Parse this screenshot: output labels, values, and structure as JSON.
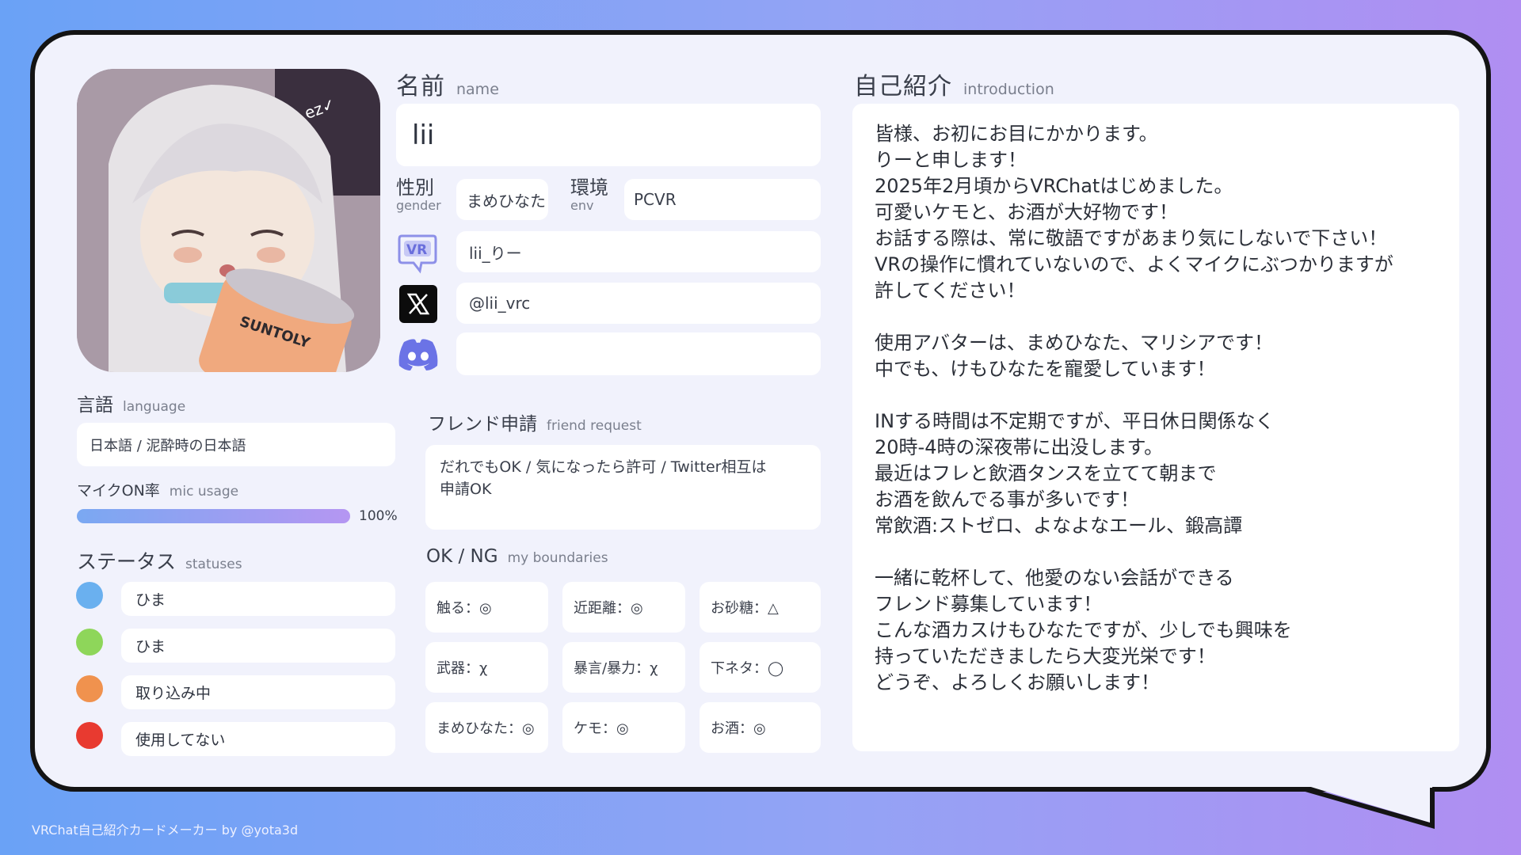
{
  "name_section": {
    "label_jp": "名前",
    "label_en": "name",
    "value": "lii"
  },
  "gender": {
    "label_jp": "性別",
    "label_en": "gender",
    "value": "まめひなた"
  },
  "env": {
    "label_jp": "環境",
    "label_en": "env",
    "value": "PCVR"
  },
  "vrchat_id": "lii_りー",
  "x_handle": "@lii_vrc",
  "discord_id": "",
  "avatar_caption": "SUNTOLY",
  "language": {
    "label_jp": "言語",
    "label_en": "language",
    "value": "日本語 / 泥酔時の日本語"
  },
  "mic": {
    "label_jp": "マイクON率",
    "label_en": "mic usage",
    "percent_text": "100%",
    "percent": 100
  },
  "statuses": {
    "label_jp": "ステータス",
    "label_en": "statuses",
    "items": [
      {
        "color": "#6ab0ef",
        "label": "ひま"
      },
      {
        "color": "#8ed65a",
        "label": "ひま"
      },
      {
        "color": "#f0924e",
        "label": "取り込み中"
      },
      {
        "color": "#e83a30",
        "label": "使用してない"
      }
    ]
  },
  "friend_request": {
    "label_jp": "フレンド申請",
    "label_en": "friend request",
    "line1": "だれでもOK / 気になったら許可 / Twitter相互は",
    "line2": "申請OK"
  },
  "boundaries": {
    "label_jp": "OK / NG",
    "label_en": "my boundaries",
    "items": [
      "触る：◎",
      "近距離：◎",
      "お砂糖：△",
      "武器：χ",
      "暴言/暴力：χ",
      "下ネタ：◯",
      "まめひなた：◎",
      "ケモ：◎",
      "お酒：◎"
    ]
  },
  "introduction": {
    "label_jp": "自己紹介",
    "label_en": "introduction",
    "lines": [
      "皆様、お初にお目にかかります。",
      "りーと申します！",
      "2025年2月頃からVRChatはじめました。",
      "可愛いケモと、お酒が大好物です！",
      "お話する際は、常に敬語ですがあまり気にしないで下さい！",
      "VRの操作に慣れていないので、よくマイクにぶつかりますが",
      "許してください！",
      "",
      "使用アバターは、まめひなた、マリシアです！",
      "中でも、けもひなたを寵愛しています！",
      "",
      "INする時間は不定期ですが、平日休日関係なく",
      "20時-4時の深夜帯に出没します。",
      "最近はフレと飲酒タンスを立てて朝まで",
      "お酒を飲んでる事が多いです！",
      "常飲酒:ストゼロ、よなよなエール、鍛高譚",
      "",
      "一緒に乾杯して、他愛のない会話ができる",
      "フレンド募集しています！",
      "こんな酒カスけもひなたですが、少しでも興味を",
      "持っていただきましたら大変光栄です！",
      "どうぞ、よろしくお願いします！"
    ]
  },
  "footer": "VRChat自己紹介カードメーカー by @yota3d",
  "colors": {
    "card_bg": "#f1f2fc",
    "border": "#141414",
    "mic_bar_start": "#7aa8f2",
    "mic_bar_end": "#b596f2"
  }
}
